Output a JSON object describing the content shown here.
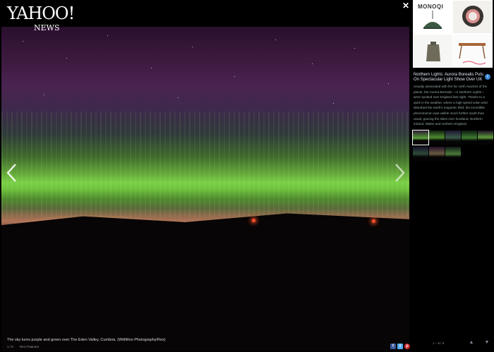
{
  "brand": {
    "name": "YAHOO!",
    "sub": "NEWS"
  },
  "viewer": {
    "caption": "The sky turns purple and green over The Eden Valley, Cumbria. (WittWoo Photography/Rex)",
    "counter": "1 / 8",
    "counter_extra": "Rex Features",
    "close_symbol": "✕"
  },
  "share": {
    "facebook": "f",
    "twitter": "t",
    "pinterest": "p"
  },
  "ad": {
    "brand": "MONOQI"
  },
  "article": {
    "title": "Northern Lights: Aurora Borealis Puts On Spectacular Light Show Over UK",
    "body": "Usually associated with the far north reaches of the planet, the Aurora Borealis – or Northern Lights – were spotted over England last night. Thanks to a quirk in the weather, where a high-speed solar wind disturbed the earth's magnetic field, the incredible phenomenon was visible much further south than usual, gracing the skies over Scotland, Northern Ireland, Wales and northern England.",
    "info_symbol": "i"
  },
  "pagination": {
    "label": "1 – 8 / 8",
    "up_symbol": "▲",
    "down_symbol": "▼"
  },
  "colors": {
    "aurora_green": "#7ad046",
    "aurora_purple": "#4a2350",
    "accent_blue": "#3a86d6"
  }
}
